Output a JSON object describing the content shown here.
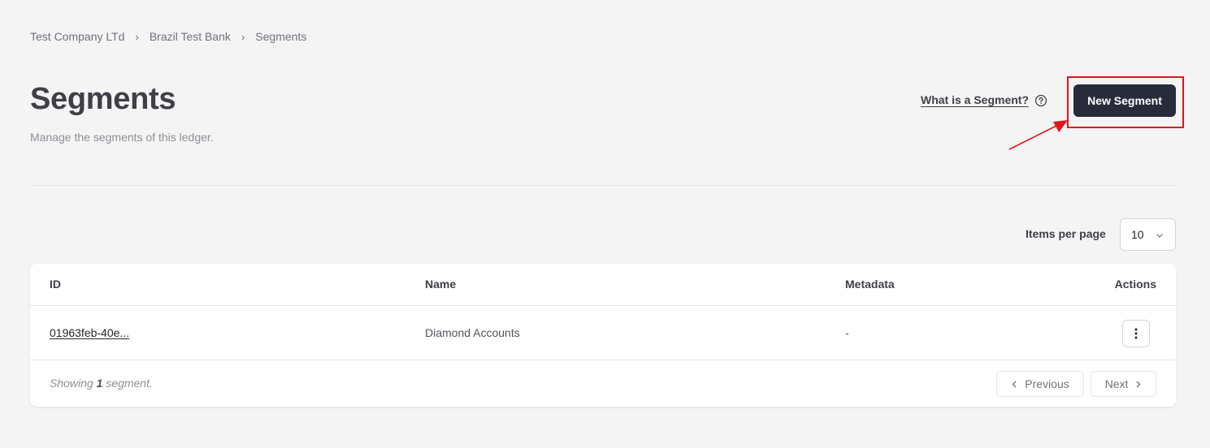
{
  "breadcrumb": {
    "items": [
      "Test Company LTd",
      "Brazil Test Bank",
      "Segments"
    ],
    "separator": "›"
  },
  "header": {
    "title": "Segments",
    "subtitle": "Manage the segments of this ledger.",
    "help_link": "What is a Segment?",
    "new_button": "New Segment"
  },
  "pagination_settings": {
    "label": "Items per page",
    "value": "10"
  },
  "table": {
    "columns": {
      "id": "ID",
      "name": "Name",
      "metadata": "Metadata",
      "actions": "Actions"
    },
    "rows": [
      {
        "id": "01963feb-40e...",
        "name": "Diamond Accounts",
        "metadata": "-"
      }
    ]
  },
  "footer": {
    "showing_prefix": "Showing",
    "count": "1",
    "showing_suffix": "segment.",
    "previous": "Previous",
    "next": "Next"
  },
  "colors": {
    "primary_button": "#272b3a",
    "annotation": "#e3131b",
    "background": "#f4f4f5"
  }
}
